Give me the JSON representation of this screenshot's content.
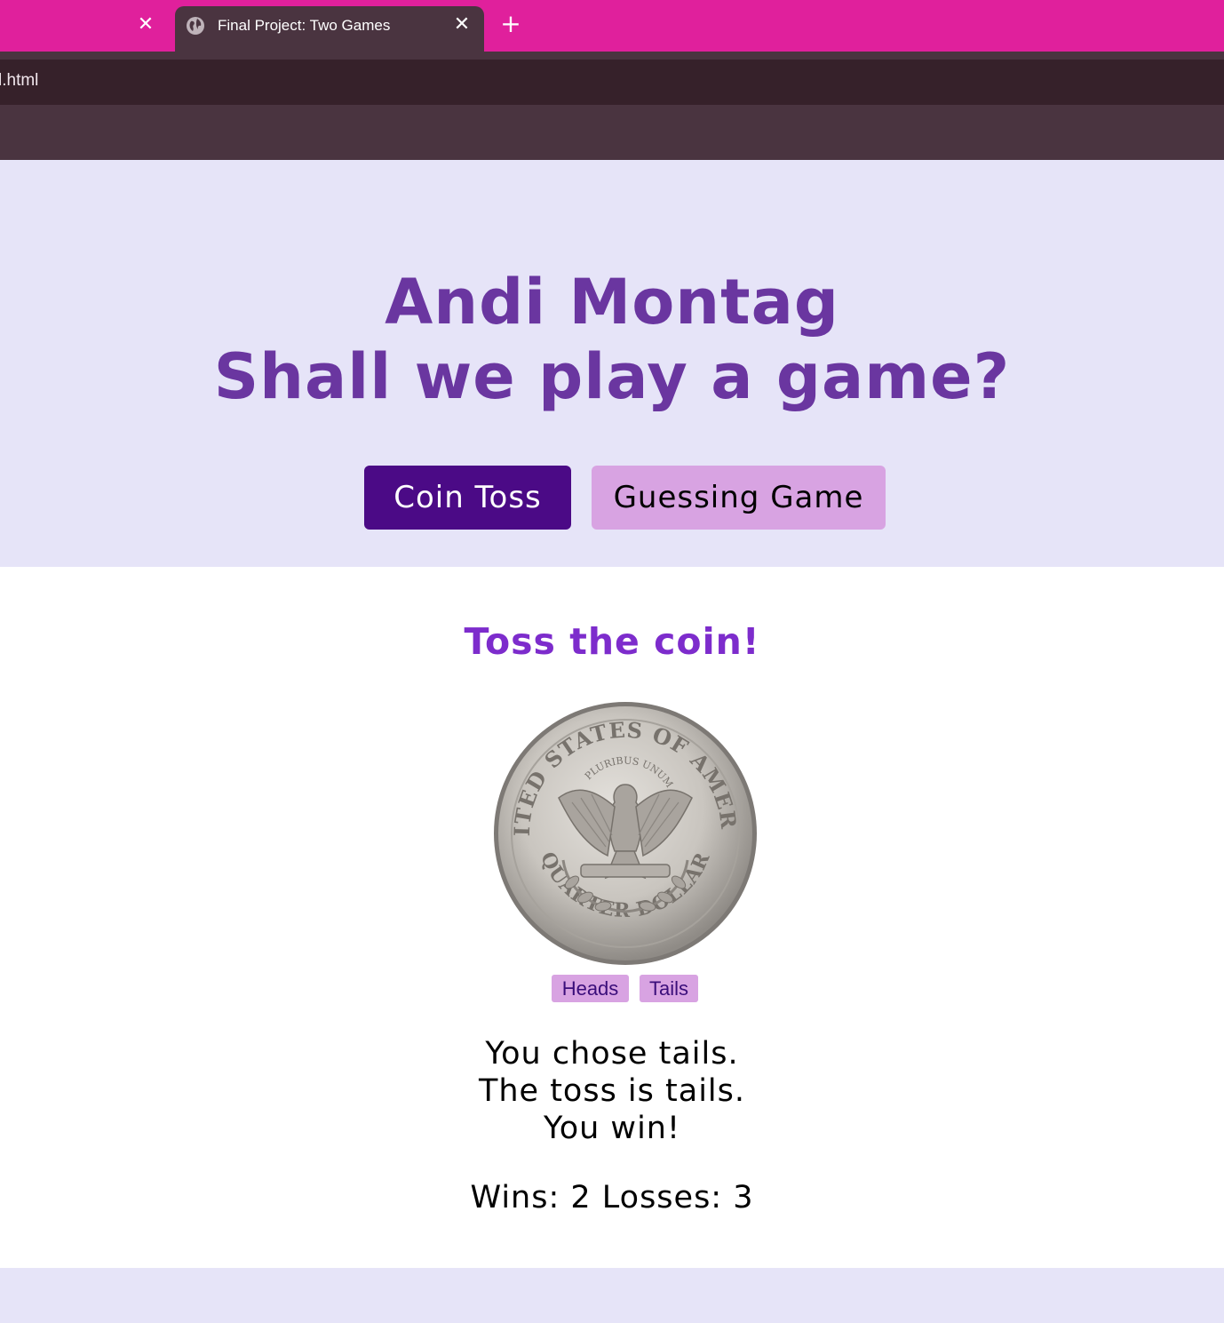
{
  "browser": {
    "active_tab_title": "Final Project: Two Games",
    "close_glyph": "✕",
    "new_tab_glyph": "+",
    "url_fragment": "l.html",
    "tabstrip_color": "#e0209c",
    "toolbar_color": "#4a3440"
  },
  "hero": {
    "name": "Andi Montag",
    "tagline": "Shall we play a game?",
    "title_color": "#6a36a0",
    "buttons": {
      "coin_toss": "Coin Toss",
      "guessing_game": "Guessing Game"
    },
    "active_color": "#4b0a86",
    "inactive_color": "#d8a3e2"
  },
  "coin_game": {
    "heading": "Toss the coin!",
    "coin_image": "quarter-dollar-reverse-icon",
    "coin_legend_top": "UNITED STATES OF AMERICA",
    "coin_motto": "E PLURIBUS UNUM",
    "coin_legend_bottom": "QUARTER DOLLAR",
    "heads_label": "Heads",
    "tails_label": "Tails",
    "result_lines": [
      "You chose tails.",
      "The toss is tails.",
      "You win!"
    ],
    "score": "Wins: 2 Losses: 3"
  }
}
